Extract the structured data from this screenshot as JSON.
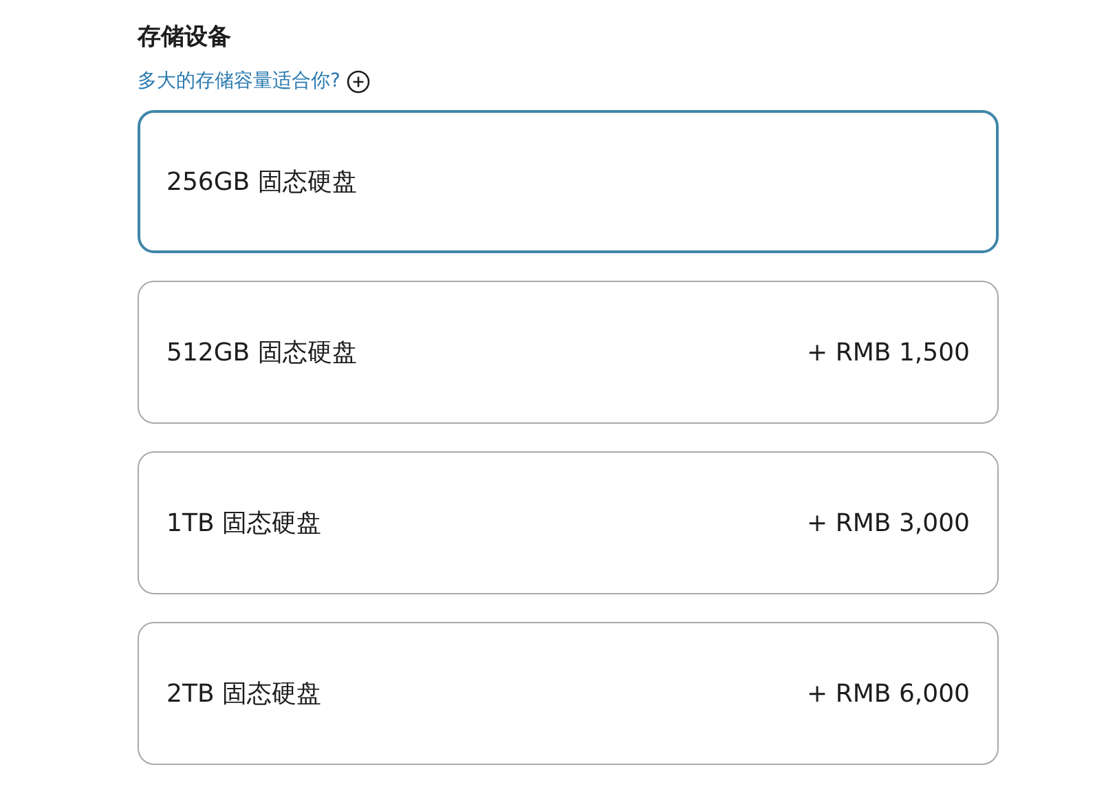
{
  "heading": "存储设备",
  "help_link": "多大的存储容量适合你?",
  "options": [
    {
      "label": "256GB 固态硬盘",
      "selected": true
    },
    {
      "label": "512GB 固态硬盘",
      "price": "+ RMB 1,500",
      "selected": false
    },
    {
      "label": "1TB 固态硬盘",
      "price": "+ RMB 3,000",
      "selected": false
    },
    {
      "label": "2TB 固态硬盘",
      "price": "+ RMB 6,000",
      "selected": false
    }
  ]
}
